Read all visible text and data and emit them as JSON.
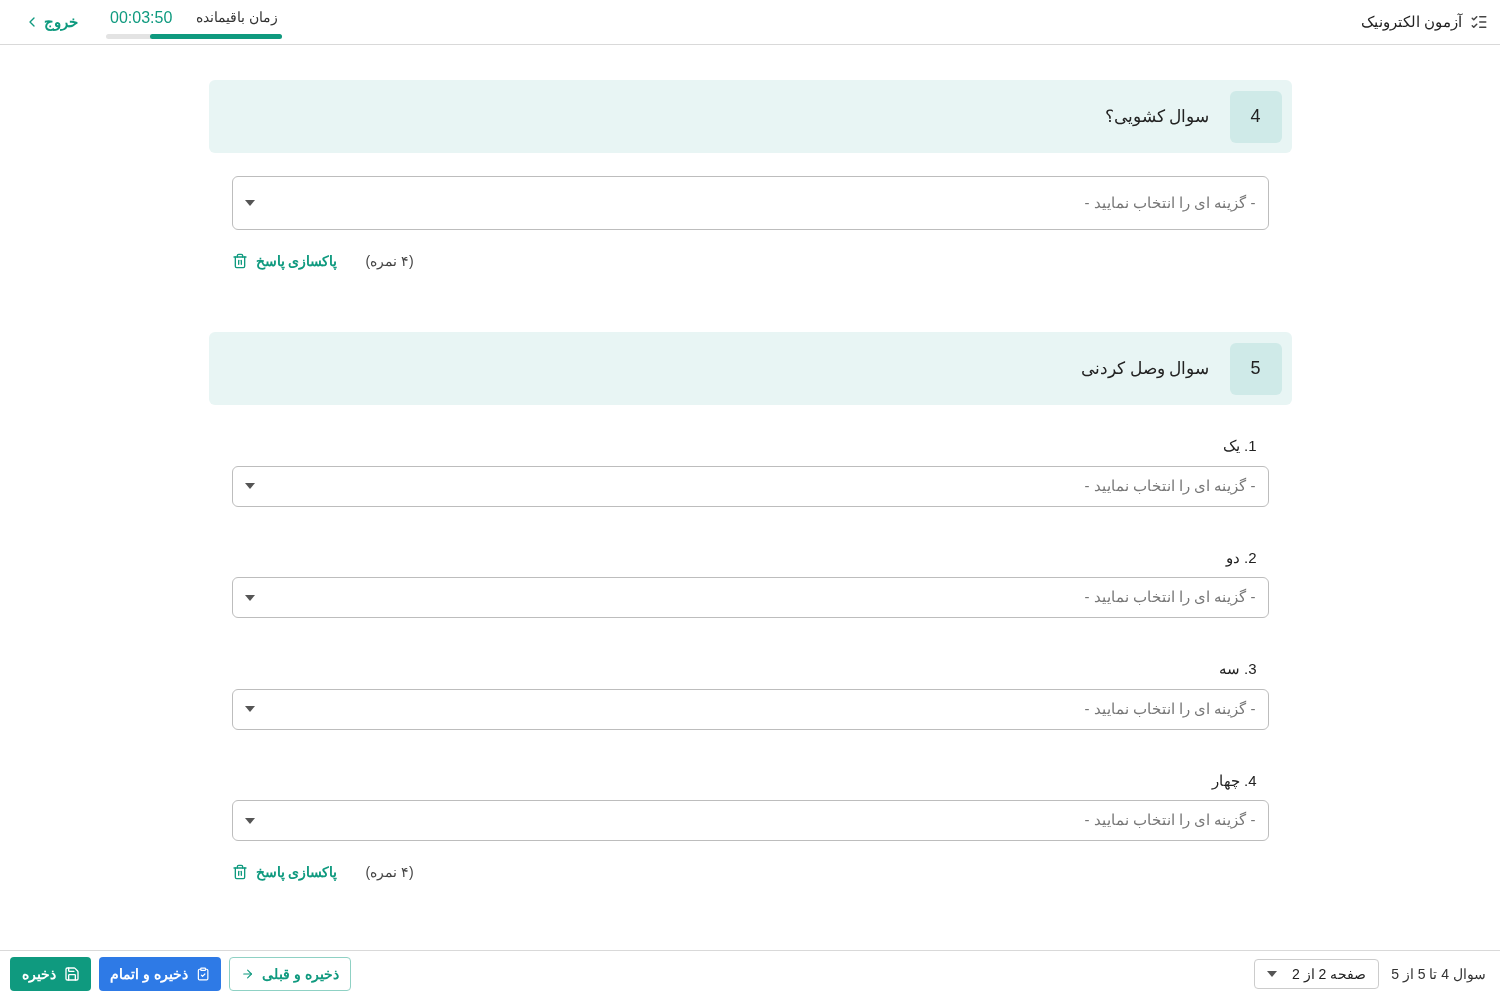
{
  "header": {
    "title": "آزمون الکترونیک",
    "timer_label": "زمان باقیمانده",
    "timer": "00:03:50",
    "time": {
      "level": 0.75
    },
    "exit": "خروج"
  },
  "questions": [
    {
      "kind": "dropdown",
      "number": "4",
      "text": "سوال کشویی؟",
      "placeholder": "- گزینه ای را انتخاب نمایید -",
      "points": "(۴ نمره)",
      "clear": "پاکسازی پاسخ"
    },
    {
      "kind": "matching",
      "number": "5",
      "text": "سوال وصل کردنی",
      "items": [
        {
          "label": "1. یک",
          "placeholder": "- گزینه ای را انتخاب نمایید -"
        },
        {
          "label": "2. دو",
          "placeholder": "- گزینه ای را انتخاب نمایید -"
        },
        {
          "label": "3. سه",
          "placeholder": "- گزینه ای را انتخاب نمایید -"
        },
        {
          "label": "4. چهار",
          "placeholder": "- گزینه ای را انتخاب نمایید -"
        }
      ],
      "points": "(۴ نمره)",
      "clear": "پاکسازی پاسخ"
    }
  ],
  "footer": {
    "range": "سوال 4 تا 5 از 5",
    "page": "صفحه 2 از 2",
    "buttons": [
      {
        "kind": "previous",
        "label": "ذخیره و قبلی"
      },
      {
        "kind": "finish",
        "label": "ذخیره و اتمام"
      },
      {
        "kind": "save",
        "label": "ذخیره"
      }
    ]
  }
}
